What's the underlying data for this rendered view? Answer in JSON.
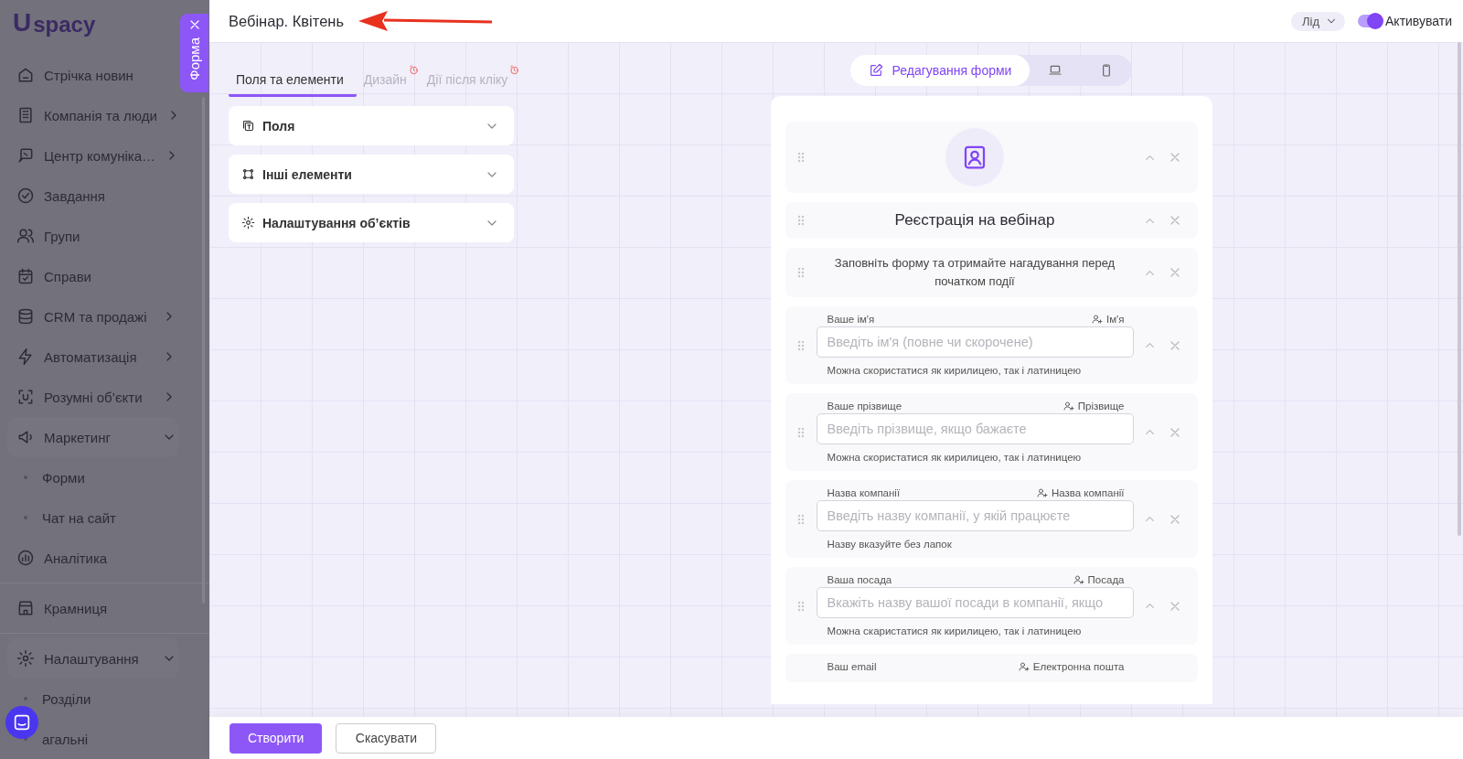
{
  "sidebar": {
    "logo": {
      "mark": "U",
      "name": "spacy"
    },
    "form_tab": {
      "label": "Форма"
    },
    "sections": [
      {
        "items": [
          {
            "kind": "link",
            "label": "Стрічка новин"
          },
          {
            "kind": "group",
            "label": "Компанія та люди",
            "expanded": false
          },
          {
            "kind": "group",
            "label": "Центр комуніка…",
            "expanded": false
          },
          {
            "kind": "link",
            "label": "Завдання"
          },
          {
            "kind": "link",
            "label": "Групи"
          },
          {
            "kind": "link",
            "label": "Справи"
          },
          {
            "kind": "group",
            "label": "CRM та продажі",
            "expanded": false
          },
          {
            "kind": "group",
            "label": "Автоматизація",
            "expanded": false
          },
          {
            "kind": "group",
            "label": "Розумні об’єкти",
            "expanded": false
          },
          {
            "kind": "group",
            "label": "Маркетинг",
            "expanded": true,
            "children": [
              {
                "label": "Форми"
              },
              {
                "label": "Чат на сайт"
              }
            ]
          },
          {
            "kind": "link",
            "label": "Аналітика"
          }
        ]
      },
      {
        "items": [
          {
            "kind": "link",
            "label": "Крамниця"
          }
        ]
      },
      {
        "items": [
          {
            "kind": "group",
            "label": "Налаштування",
            "expanded": true,
            "children": [
              {
                "label": "Розділи"
              },
              {
                "label": "агальні"
              }
            ]
          }
        ]
      }
    ]
  },
  "header": {
    "title": "Вебінар. Квітень",
    "entity": {
      "value": "Лід"
    },
    "activate": {
      "label": "Активувати",
      "on": true
    }
  },
  "left_panel": {
    "tabs": [
      {
        "label": "Поля та елементи",
        "selected": true,
        "alert": false
      },
      {
        "label": "Дизайн",
        "selected": false,
        "alert": true
      },
      {
        "label": "Дії після кліку",
        "selected": false,
        "alert": true
      }
    ],
    "sections": [
      {
        "label": "Поля",
        "expanded": false
      },
      {
        "label": "Інші елементи",
        "expanded": false
      },
      {
        "label": "Налаштування об’єктів",
        "expanded": false
      }
    ]
  },
  "preview": {
    "modes": [
      {
        "kind": "edit",
        "label": "Редагування форми",
        "selected": true
      },
      {
        "kind": "desktop",
        "selected": false
      },
      {
        "kind": "mobile",
        "selected": false
      }
    ],
    "blocks": [
      {
        "kind": "image"
      },
      {
        "kind": "heading",
        "text": "Реєстрація на вебінар"
      },
      {
        "kind": "text",
        "text": "Заповніть форму та отримайте нагадування перед початком події"
      },
      {
        "kind": "field",
        "label": "Ваше ім'я",
        "mapping": "Ім'я",
        "placeholder": "Введіть ім'я (повне чи скорочене)",
        "hint": "Можна скористатися як кирилицею, так і латиницею"
      },
      {
        "kind": "field",
        "label": "Ваше прізвище",
        "mapping": "Прізвище",
        "placeholder": "Введіть прізвище, якщо бажаєте",
        "hint": "Можна скористатися як кирилицею, так і латиницею"
      },
      {
        "kind": "field",
        "label": "Назва компанії",
        "mapping": "Назва компанії",
        "placeholder": "Введіть назву компанії, у якій працюєте",
        "hint": "Назву вказуйте без лапок"
      },
      {
        "kind": "field",
        "label": "Ваша посада",
        "mapping": "Посада",
        "placeholder": "Вкажіть назву вашої посади в компанії, якщо",
        "hint": "Можна скаристатися як кирилицею, так і латиницею"
      },
      {
        "kind": "field",
        "label": "Ваш email",
        "mapping": "Електронна пошта"
      }
    ]
  },
  "footer": {
    "buttons": [
      {
        "kind": "primary",
        "label": "Створити"
      },
      {
        "kind": "secondary",
        "label": "Скасувати"
      }
    ]
  }
}
